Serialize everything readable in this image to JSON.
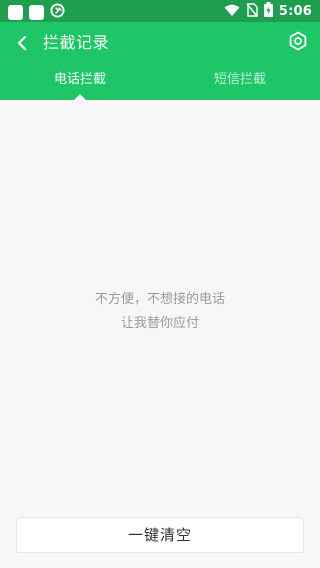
{
  "status_bar": {
    "time": "5:06",
    "icons": [
      "square-icon",
      "square-icon",
      "data-saver-icon",
      "wifi-icon",
      "no-sim-icon",
      "battery-charging-icon"
    ]
  },
  "app_bar": {
    "title": "拦截记录",
    "back_icon": "chevron-left-icon",
    "settings_icon": "hexagon-settings-icon"
  },
  "tabs": [
    {
      "label": "电话拦截",
      "active": true
    },
    {
      "label": "短信拦截",
      "active": false
    }
  ],
  "empty_state": {
    "line1": "不方便，不想接的电话",
    "line2": "让我替你应付"
  },
  "bottom": {
    "clear_label": "一键清空"
  },
  "colors": {
    "status_bar": "#1f9e50",
    "app_bar": "#1ec667",
    "background": "#f7f7f7",
    "muted_text": "#9a9a9a"
  }
}
